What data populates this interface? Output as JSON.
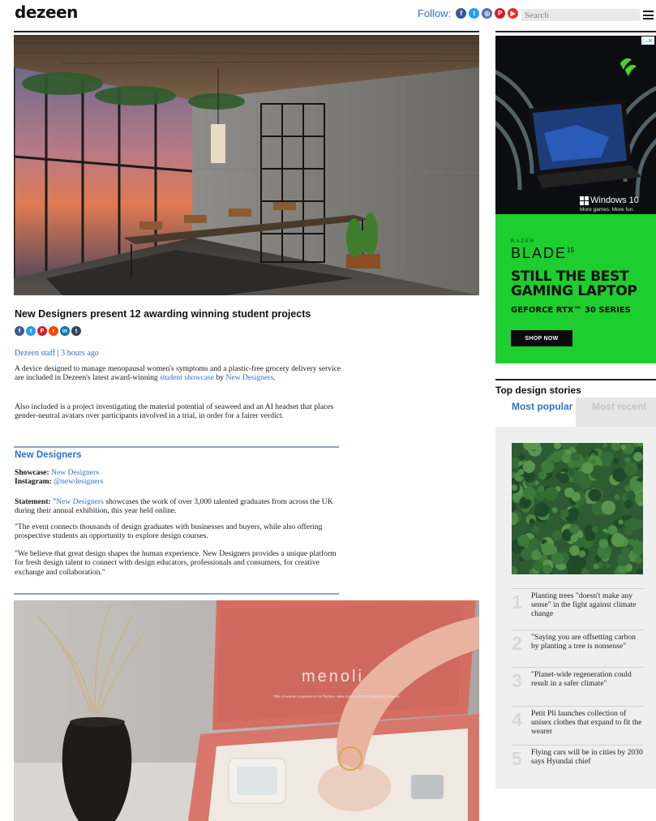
{
  "header": {
    "logo": "dezeen",
    "follow_label": "Follow:",
    "social": [
      {
        "icon": "facebook-icon",
        "glyph": "f",
        "color": "#3b5998"
      },
      {
        "icon": "twitter-icon",
        "glyph": "t",
        "color": "#1da1f2"
      },
      {
        "icon": "instagram-icon",
        "glyph": "◎",
        "color": "#5b6bb5"
      },
      {
        "icon": "pinterest-icon",
        "glyph": "P",
        "color": "#d11e2f"
      },
      {
        "icon": "youtube-icon",
        "glyph": "▶",
        "color": "#e52d27"
      }
    ],
    "search_placeholder": "Search"
  },
  "article": {
    "title": "New Designers present 12 awarding winning student projects",
    "share_icons": [
      {
        "icon": "facebook-icon",
        "glyph": "f",
        "color": "#3b5998"
      },
      {
        "icon": "twitter-icon",
        "glyph": "t",
        "color": "#1da1f2"
      },
      {
        "icon": "pinterest-icon",
        "glyph": "P",
        "color": "#d11e2f"
      },
      {
        "icon": "reddit-icon",
        "glyph": "r",
        "color": "#ff4500"
      },
      {
        "icon": "linkedin-icon",
        "glyph": "in",
        "color": "#0077b5"
      },
      {
        "icon": "tumblr-icon",
        "glyph": "t",
        "color": "#35465c"
      }
    ],
    "author": "Dezeen staff",
    "separator": "|",
    "time": "3 hours ago",
    "p1_a": "A device designed to manage menopausal women's symptoms and a plastic-free grocery delivery service are included in Dezeen's latest award-winning ",
    "p1_link1": "student showcase",
    "p1_b": " by ",
    "p1_link2": "New Designers",
    "p1_c": ".",
    "p2": "Also included is a project investigating the material potential of seaweed and an AI headset that places gender-neutral avatars over participants involved in a trial, in order for a fairer verdict.",
    "section_heading": "New Designers",
    "showcase_label": "Showcase:",
    "showcase_value": "New Designers",
    "instagram_label": "Instagram:",
    "instagram_value": "@newdesigners",
    "statement_label": "Statement:",
    "statement_open": " \"",
    "statement_link": "New Designers",
    "statement_rest": " showcases the work of over 3,000 talented graduates from across the UK during their annual exhibition, this year held online.",
    "p4": "\"The event connects thousands of design graduates with businesses and buyers, while also offering prospective students an opportunity to explore design courses.",
    "p5": "\"We believe that great design shapes the human experience. New Designers provides a unique platform for fresh design talent to connect with design educators, professionals and consumers, for creative exchange and collaboration.\"",
    "photo2_brand_text": "menoli",
    "photo2_box_text": "79% of women experience hot flushes. take control of your symptoms, at work."
  },
  "ad": {
    "adchoices": "▷✕",
    "windows_label": "Windows 10",
    "windows_tagline": "More games. More fun.",
    "brand": "RAZER",
    "product": "BLADE",
    "product_size": "15",
    "headline": "STILL THE BEST GAMING LAPTOP",
    "subline": "GEFORCE RTX™ 30 SERIES",
    "cta": "SHOP NOW",
    "colors": {
      "green": "#1dce2f",
      "dark": "#0c0d10"
    }
  },
  "top_stories": {
    "title": "Top design stories",
    "tab_popular": "Most popular",
    "tab_recent": "Most recent",
    "items": [
      {
        "num": "1",
        "text": "Planting trees \"doesn't make any sense\" in the fight against climate change"
      },
      {
        "num": "2",
        "text": "\"Saying you are offsetting carbon by planting a tree is nonsense\""
      },
      {
        "num": "3",
        "text": "\"Planet-wide regeneration could result in a safer climate\""
      },
      {
        "num": "4",
        "text": "Petit Pli launches collection of unisex clothes that expand to fit the wearer"
      },
      {
        "num": "5",
        "text": "Flying cars will be in cities by 2030 says Hyundai chief"
      }
    ]
  },
  "colors": {
    "link": "#3470c7",
    "rule": "#8aa4cf"
  }
}
